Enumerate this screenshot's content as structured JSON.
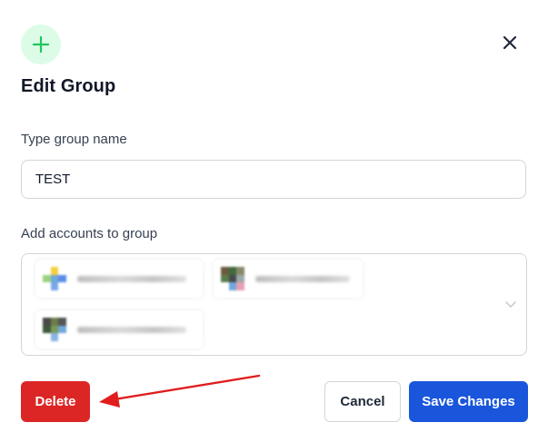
{
  "dialog": {
    "title": "Edit Group",
    "header_icon": "plus-icon",
    "close_icon": "close-icon"
  },
  "group_name": {
    "label": "Type group name",
    "value": "TEST"
  },
  "accounts": {
    "label": "Add accounts to group",
    "selected_count": 3,
    "dropdown_icon": "chevron-down-icon"
  },
  "actions": {
    "delete_label": "Delete",
    "cancel_label": "Cancel",
    "save_label": "Save Changes"
  },
  "colors": {
    "accent_green": "#22c55e",
    "delete_red": "#dc2626",
    "save_blue": "#1a56db",
    "annotation_arrow": "#e11d1d"
  }
}
